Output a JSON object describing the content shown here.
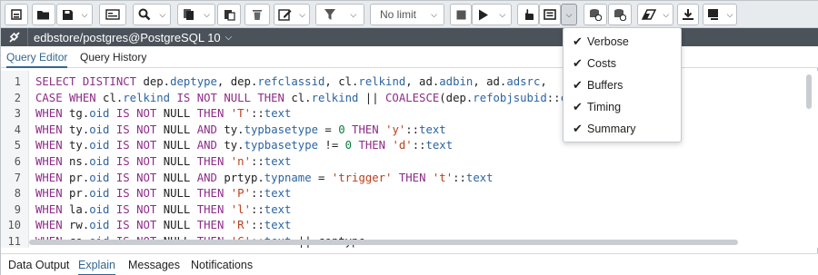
{
  "toolbar": {
    "limit_value": "No limit"
  },
  "connection": {
    "label": "edbstore/postgres@PostgreSQL 10"
  },
  "editor_tabs": [
    "Query Editor",
    "Query History"
  ],
  "code": {
    "lines": [
      {
        "n": "1",
        "tokens": [
          [
            "kw",
            "SELECT DISTINCT "
          ],
          [
            "",
            "dep."
          ],
          [
            "col",
            "deptype"
          ],
          [
            "",
            ", dep."
          ],
          [
            "col",
            "refclassid"
          ],
          [
            "",
            ", cl."
          ],
          [
            "col",
            "relkind"
          ],
          [
            "",
            ", ad."
          ],
          [
            "col",
            "adbin"
          ],
          [
            "",
            ", ad."
          ],
          [
            "col",
            "adsrc"
          ],
          [
            "",
            ","
          ]
        ]
      },
      {
        "n": "2",
        "tokens": [
          [
            "kw",
            "CASE WHEN "
          ],
          [
            "",
            "cl."
          ],
          [
            "col",
            "relkind"
          ],
          [
            "kw",
            " IS NOT NULL THEN "
          ],
          [
            "",
            "cl."
          ],
          [
            "col",
            "relkind"
          ],
          [
            "",
            " || "
          ],
          [
            "kw",
            "COALESCE"
          ],
          [
            "",
            "(dep."
          ],
          [
            "col",
            "refobjsubid"
          ],
          [
            "",
            "::"
          ],
          [
            "col",
            "chara"
          ]
        ]
      },
      {
        "n": "3",
        "tokens": [
          [
            "kw",
            "WHEN "
          ],
          [
            "",
            "tg."
          ],
          [
            "col",
            "oid"
          ],
          [
            "kw",
            " IS NOT "
          ],
          [
            "",
            "NULL "
          ],
          [
            "kw",
            "THEN "
          ],
          [
            "str",
            "'T'"
          ],
          [
            "",
            "::"
          ],
          [
            "col",
            "text"
          ]
        ]
      },
      {
        "n": "4",
        "tokens": [
          [
            "kw",
            "WHEN "
          ],
          [
            "",
            "ty."
          ],
          [
            "col",
            "oid"
          ],
          [
            "kw",
            " IS NOT "
          ],
          [
            "",
            "NULL "
          ],
          [
            "kw",
            "AND "
          ],
          [
            "",
            "ty."
          ],
          [
            "col",
            "typbasetype"
          ],
          [
            "",
            " = "
          ],
          [
            "num",
            "0"
          ],
          [
            "kw",
            " THEN "
          ],
          [
            "str",
            "'y'"
          ],
          [
            "",
            "::"
          ],
          [
            "col",
            "text"
          ]
        ]
      },
      {
        "n": "5",
        "tokens": [
          [
            "kw",
            "WHEN "
          ],
          [
            "",
            "ty."
          ],
          [
            "col",
            "oid"
          ],
          [
            "kw",
            " IS NOT "
          ],
          [
            "",
            "NULL "
          ],
          [
            "kw",
            "AND "
          ],
          [
            "",
            "ty."
          ],
          [
            "col",
            "typbasetype"
          ],
          [
            "",
            " != "
          ],
          [
            "num",
            "0"
          ],
          [
            "kw",
            " THEN "
          ],
          [
            "str",
            "'d'"
          ],
          [
            "",
            "::"
          ],
          [
            "col",
            "text"
          ]
        ]
      },
      {
        "n": "6",
        "tokens": [
          [
            "kw",
            "WHEN "
          ],
          [
            "",
            "ns."
          ],
          [
            "col",
            "oid"
          ],
          [
            "kw",
            " IS NOT "
          ],
          [
            "",
            "NULL "
          ],
          [
            "kw",
            "THEN "
          ],
          [
            "str",
            "'n'"
          ],
          [
            "",
            "::"
          ],
          [
            "col",
            "text"
          ]
        ]
      },
      {
        "n": "7",
        "tokens": [
          [
            "kw",
            "WHEN "
          ],
          [
            "",
            "pr."
          ],
          [
            "col",
            "oid"
          ],
          [
            "kw",
            " IS NOT "
          ],
          [
            "",
            "NULL "
          ],
          [
            "kw",
            "AND "
          ],
          [
            "",
            "prtyp."
          ],
          [
            "col",
            "typname"
          ],
          [
            "",
            " = "
          ],
          [
            "str",
            "'trigger'"
          ],
          [
            "kw",
            " THEN "
          ],
          [
            "str",
            "'t'"
          ],
          [
            "",
            "::"
          ],
          [
            "col",
            "text"
          ]
        ]
      },
      {
        "n": "8",
        "tokens": [
          [
            "kw",
            "WHEN "
          ],
          [
            "",
            "pr."
          ],
          [
            "col",
            "oid"
          ],
          [
            "kw",
            " IS NOT "
          ],
          [
            "",
            "NULL "
          ],
          [
            "kw",
            "THEN "
          ],
          [
            "str",
            "'P'"
          ],
          [
            "",
            "::"
          ],
          [
            "col",
            "text"
          ]
        ]
      },
      {
        "n": "9",
        "tokens": [
          [
            "kw",
            "WHEN "
          ],
          [
            "",
            "la."
          ],
          [
            "col",
            "oid"
          ],
          [
            "kw",
            " IS NOT "
          ],
          [
            "",
            "NULL "
          ],
          [
            "kw",
            "THEN "
          ],
          [
            "str",
            "'l'"
          ],
          [
            "",
            "::"
          ],
          [
            "col",
            "text"
          ]
        ]
      },
      {
        "n": "10",
        "tokens": [
          [
            "kw",
            "WHEN "
          ],
          [
            "",
            "rw."
          ],
          [
            "col",
            "oid"
          ],
          [
            "kw",
            " IS NOT "
          ],
          [
            "",
            "NULL "
          ],
          [
            "kw",
            "THEN "
          ],
          [
            "str",
            "'R'"
          ],
          [
            "",
            "::"
          ],
          [
            "col",
            "text"
          ]
        ]
      },
      {
        "n": "11",
        "tokens": [
          [
            "kw",
            "WHEN "
          ],
          [
            "",
            "co."
          ],
          [
            "col",
            "oid"
          ],
          [
            "kw",
            " IS NOT "
          ],
          [
            "",
            "NULL "
          ],
          [
            "kw",
            "THEN "
          ],
          [
            "str",
            "'C'"
          ],
          [
            "",
            "::"
          ],
          [
            "col",
            "text"
          ],
          [
            "",
            " || contype"
          ]
        ]
      }
    ]
  },
  "explain_menu": {
    "items": [
      "Verbose",
      "Costs",
      "Buffers",
      "Timing",
      "Summary"
    ]
  },
  "bottom_tabs": [
    "Data Output",
    "Explain",
    "Messages",
    "Notifications"
  ],
  "colors": {
    "accent": "#326690",
    "keyword": "#8e2c89",
    "string": "#bb3f1d",
    "identifier": "#2d64a0",
    "number": "#0c7a3e",
    "connection_bar": "#4b525a"
  }
}
